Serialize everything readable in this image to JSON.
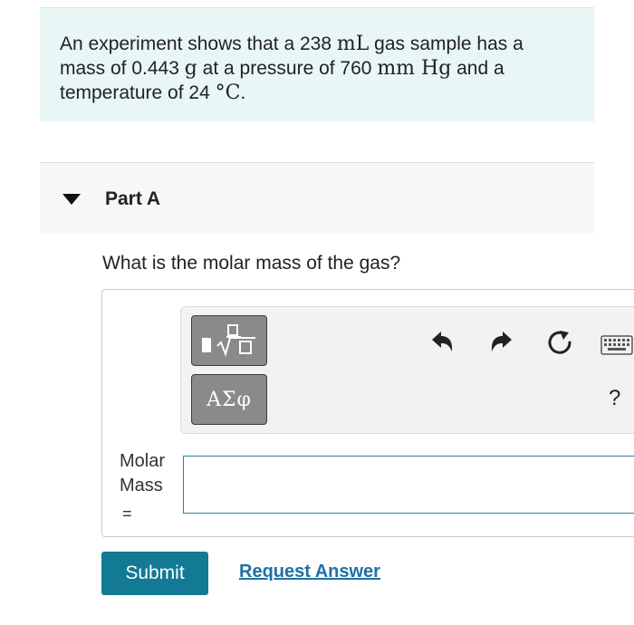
{
  "problem": {
    "t1": "An experiment shows that a 238 ",
    "u1": "mL",
    "t2": " gas sample has a mass of 0.443 ",
    "u2": "g",
    "t3": " at a pressure of 760 ",
    "u3": "mm Hg",
    "t4": " and a temperature of 24 ",
    "u4": "°C",
    "t5": "."
  },
  "part": {
    "title": "Part A"
  },
  "question": "What is the molar mass of the gas?",
  "toolbar": {
    "greek_label": "ΑΣφ",
    "help_label": "?"
  },
  "answer": {
    "label_line1": "Molar",
    "label_line2": "Mass",
    "equals": "=",
    "value": ""
  },
  "actions": {
    "submit_label": "Submit",
    "request_label": "Request Answer"
  },
  "colors": {
    "problem_bg": "#e8f6f5",
    "submit_bg": "#127a95",
    "link": "#1e6fa3",
    "input_border": "#2a7fa1"
  }
}
